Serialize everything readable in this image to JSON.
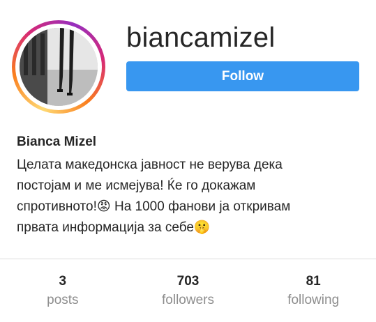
{
  "profile": {
    "username": "biancamizel",
    "follow_label": "Follow",
    "full_name": "Bianca Mizel",
    "bio": "Целата македонска јавност не верува дека\nпостојам и ме исмејува! Ќе го докажам\nспротивното!😡 На 1000 фанови ја откривам\nпрвата информација за себе🤫"
  },
  "stats": [
    {
      "count": "3",
      "label": "posts"
    },
    {
      "count": "703",
      "label": "followers"
    },
    {
      "count": "81",
      "label": "following"
    }
  ],
  "colors": {
    "follow_button": "#3897f0",
    "text": "#262626",
    "muted": "#8e8e8e",
    "divider": "#dbdbdb"
  }
}
